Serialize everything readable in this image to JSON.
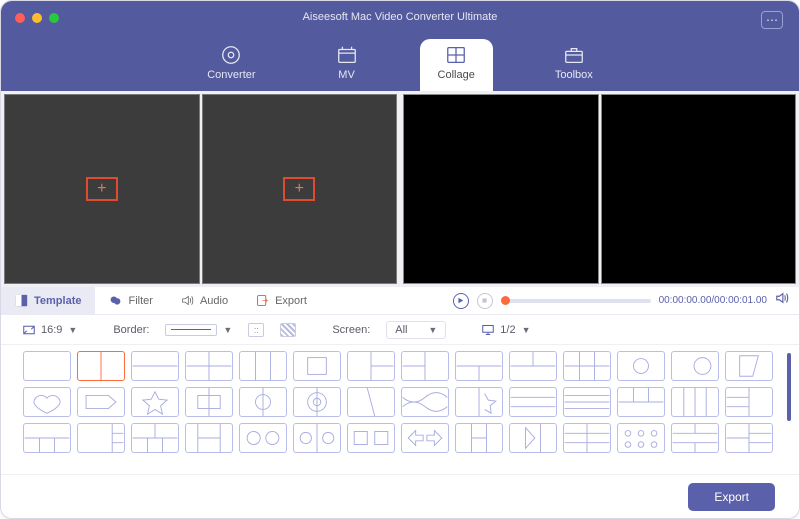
{
  "app": {
    "title": "Aiseesoft Mac Video Converter Ultimate"
  },
  "nav": {
    "converter": "Converter",
    "mv": "MV",
    "collage": "Collage",
    "toolbox": "Toolbox"
  },
  "tabs": {
    "template": "Template",
    "filter": "Filter",
    "audio": "Audio",
    "export": "Export"
  },
  "player": {
    "time": "00:00:00.00/00:00:01.00"
  },
  "options": {
    "ratio": "16:9",
    "border_label": "Border:",
    "screen_label": "Screen:",
    "screen_value": "All",
    "page": "1/2"
  },
  "footer": {
    "export": "Export"
  }
}
